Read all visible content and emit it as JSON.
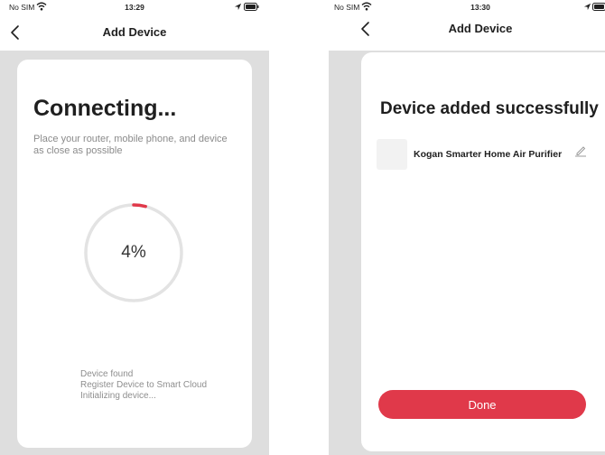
{
  "colors": {
    "accent": "#e0394a",
    "background": "#dedede",
    "card": "#ffffff",
    "ring_track": "#e3e3e3",
    "muted_text": "#8b8b8b"
  },
  "screens": {
    "connecting": {
      "status_bar": {
        "carrier": "No SIM",
        "time": "13:29"
      },
      "nav": {
        "title": "Add Device",
        "back_icon": "chevron-left-icon"
      },
      "title": "Connecting...",
      "hint": "Place your router, mobile phone, and device as close as possible",
      "progress": {
        "value": 4,
        "label": "4%"
      },
      "steps": [
        "Device found",
        "Register Device to Smart Cloud",
        "Initializing device..."
      ]
    },
    "success": {
      "status_bar": {
        "carrier": "No SIM",
        "time": "13:30"
      },
      "nav": {
        "title": "Add Device",
        "back_icon": "chevron-left-icon"
      },
      "title": "Device added successfully",
      "device": {
        "name": "Kogan Smarter Home Air Purifier",
        "edit_icon": "pencil-icon"
      },
      "done_label": "Done"
    }
  }
}
